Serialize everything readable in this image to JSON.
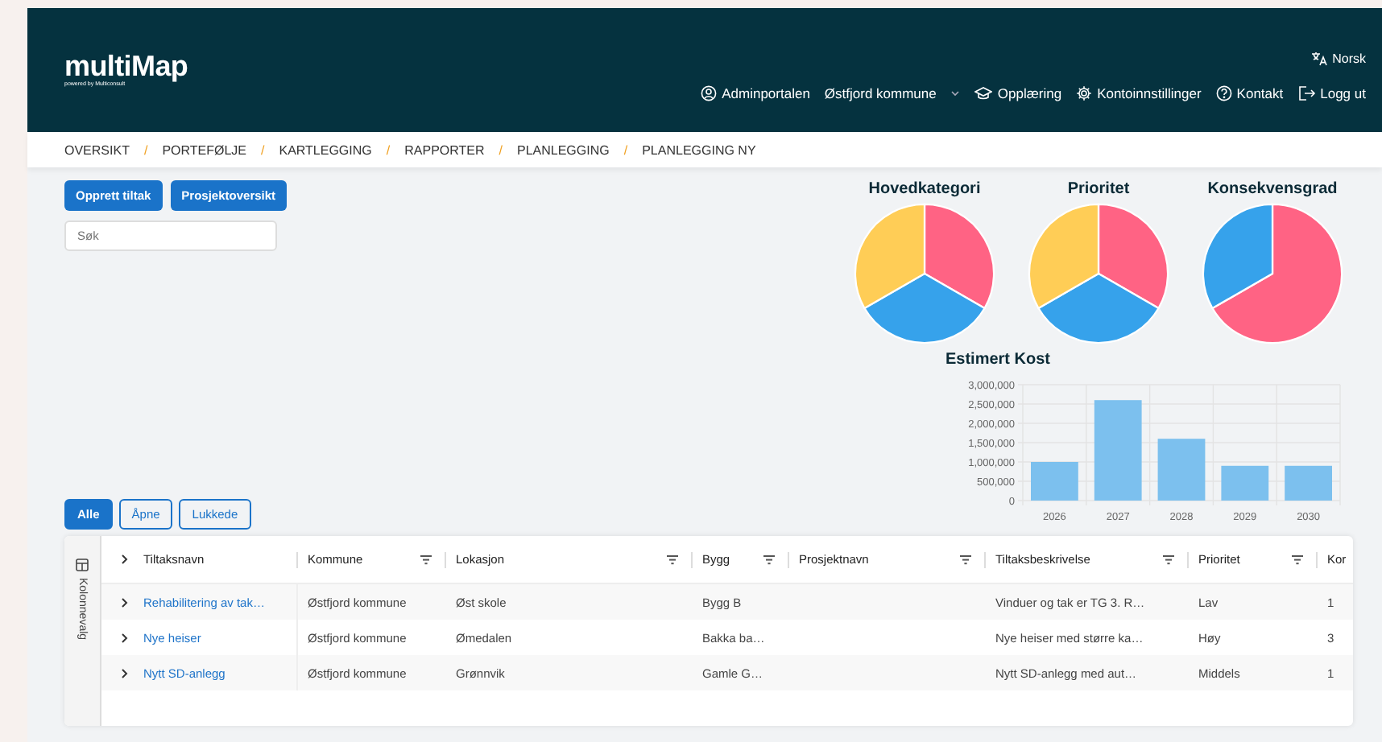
{
  "header": {
    "logo": "multiMap",
    "logo_subtitle": "powered by Multiconsult",
    "language": "Norsk",
    "nav": [
      {
        "label": "Adminportalen",
        "kind": "person"
      },
      {
        "label": "Østfjord kommune",
        "kind": "dropdown"
      },
      {
        "label": "Opplæring",
        "kind": "cap"
      },
      {
        "label": "Kontoinnstillinger",
        "kind": "gear"
      },
      {
        "label": "Kontakt",
        "kind": "help"
      },
      {
        "label": "Logg ut",
        "kind": "logout"
      }
    ]
  },
  "breadcrumb": {
    "separator": "/",
    "items": [
      "OVERSIKT",
      "PORTEFØLJE",
      "KARTLEGGING",
      "RAPPORTER",
      "PLANLEGGING",
      "PLANLEGGING NY"
    ]
  },
  "actions": [
    "Opprett tiltak",
    "Prosjektoversikt"
  ],
  "search": {
    "placeholder": "Søk"
  },
  "pie_charts": [
    {
      "title": "Hovedkategori",
      "kind": "picture"
    },
    {
      "title": "Prioritet",
      "kind": "picture"
    },
    {
      "title": "Konsekvensgrad",
      "kind": "picture"
    }
  ],
  "cost_chart": {
    "chart_data": {
      "type": "bar",
      "title": "Estimert Kost",
      "categories": [
        "2026",
        "2027",
        "2028",
        "2029",
        "2030"
      ],
      "grid": true,
      "series": [
        {
          "color": "#7cc0ee",
          "values": [
            1000000,
            2600000,
            1600000,
            900000,
            900000
          ]
        }
      ],
      "ylim": [
        0,
        3000000
      ],
      "yticks": [
        {
          "value": 0,
          "label": "0"
        },
        {
          "value": 500000,
          "label": "500,000"
        },
        {
          "value": 1000000,
          "label": "1,000,000"
        },
        {
          "value": 1500000,
          "label": "1,500,000"
        },
        {
          "value": 2000000,
          "label": "2,000,000"
        },
        {
          "value": 2500000,
          "label": "2,500,000"
        },
        {
          "value": 3000000,
          "label": "3,000,000"
        }
      ]
    }
  },
  "filters": [
    {
      "label": "Alle",
      "selected": true
    },
    {
      "label": "Åpne",
      "selected": false
    },
    {
      "label": "Lukkede",
      "selected": false
    }
  ],
  "table": {
    "side_panel": "Kolonnevalg",
    "columns": [
      {
        "label": "Tiltaksnavn",
        "filter": false
      },
      {
        "label": "Kommune",
        "filter": true
      },
      {
        "label": "Lokasjon",
        "filter": true
      },
      {
        "label": "Bygg",
        "filter": true
      },
      {
        "label": "Prosjektnavn",
        "filter": true
      },
      {
        "label": "Tiltaksbeskrivelse",
        "filter": true
      },
      {
        "label": "Prioritet",
        "filter": true
      },
      {
        "label": "Kor",
        "filter": false
      }
    ],
    "rows": [
      [
        "Rehabilitering av tak…",
        "Østfjord kommune",
        "Øst skole",
        "Bygg B",
        "",
        "Vinduer og tak er TG 3. R…",
        "Lav",
        "1"
      ],
      [
        "Nye heiser",
        "Østfjord kommune",
        "Ømedalen",
        "Bakka ba…",
        "",
        "Nye heiser med større ka…",
        "Høy",
        "3"
      ],
      [
        "Nytt SD-anlegg",
        "Østfjord kommune",
        "Grønnvik",
        "Gamle G…",
        "",
        "Nytt SD-anlegg med aut…",
        "Middels",
        "1"
      ]
    ]
  }
}
